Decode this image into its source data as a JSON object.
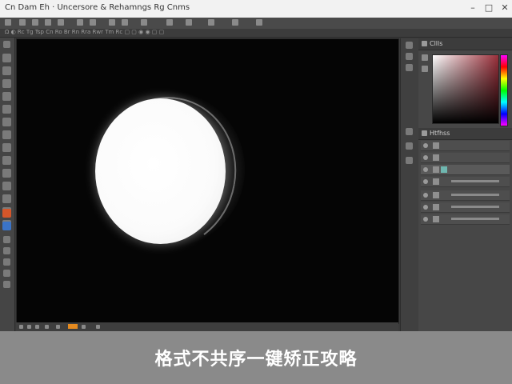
{
  "window": {
    "title": "Cn Dam Eh · Uncersore & Rehamngs Rg Cnms",
    "controls": [
      "–",
      "□",
      "✕"
    ]
  },
  "menubar": {
    "items": []
  },
  "options_bar": {
    "hint": "Ω ◐ Rc Tg Tsp Cn Ro Br Rn Rra Rwr Tm Rc ▢ ▢ ◉ ◉ ▢ ▢"
  },
  "toolbar": {
    "tools": [
      "move-tool",
      "marquee-tool",
      "lasso-tool",
      "quick-select-tool",
      "crop-tool",
      "eyedropper-tool",
      "healing-tool",
      "brush-tool",
      "stamp-tool",
      "history-brush-tool",
      "eraser-tool",
      "gradient-tool",
      "blur-tool",
      "dodge-tool",
      "pen-tool",
      "text-tool",
      "path-select-tool",
      "shape-tool",
      "hand-tool",
      "zoom-tool"
    ]
  },
  "canvas": {
    "subject": ""
  },
  "status_bar": {
    "progress_color": "#e58a1f"
  },
  "color_panel": {
    "title": "Cllls",
    "base_hue": "#9a2f3a"
  },
  "layers_panel": {
    "title": "Htfhss",
    "rows": [
      {
        "name": "",
        "selected": false
      },
      {
        "name": "",
        "selected": false
      },
      {
        "name": "",
        "selected": true
      },
      {
        "name": "",
        "selected": false
      },
      {
        "name": "",
        "selected": false
      },
      {
        "name": "",
        "selected": false
      },
      {
        "name": "",
        "selected": false
      }
    ]
  },
  "caption": {
    "text": "格式不共序一键矫正攻略"
  },
  "colors": {
    "accent": "#e58a1f",
    "canvas_bg": "#050505",
    "caption_band": "#8a8a8a",
    "ui_dark": "#3a3a3a"
  }
}
